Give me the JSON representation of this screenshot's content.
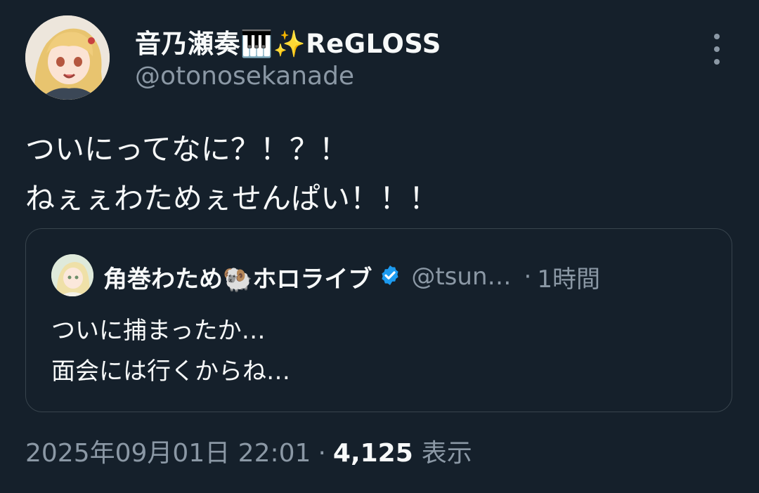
{
  "author": {
    "display_name": "音乃瀬奏🎹✨ReGLOSS",
    "handle": "@otonosekanade"
  },
  "tweet": {
    "lines": [
      "ついにってなに？！？！",
      "ねぇぇわためぇせんぱい！！！"
    ]
  },
  "quoted_tweet": {
    "display_name": "角巻わため🐏ホロライブ",
    "handle": "@tsun…",
    "separator": "·",
    "time": "1時間",
    "lines": [
      "ついに捕まったか…",
      "面会には行くからね…"
    ]
  },
  "meta": {
    "timestamp": "2025年09月01日 22:01",
    "separator": "·",
    "views": "4,125",
    "views_label": "表示"
  },
  "icons": {
    "more": "more-vertical-icon",
    "verified": "verified-badge-icon"
  },
  "colors": {
    "background": "#15202b",
    "primary_text": "#f7f9f9",
    "secondary_text": "#8b98a5",
    "border": "#38444d",
    "verified": "#1d9bf0"
  }
}
